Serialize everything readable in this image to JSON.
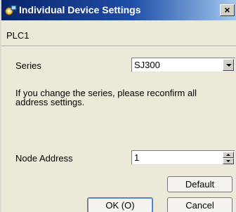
{
  "window": {
    "title": "Individual Device Settings",
    "close_label": "×"
  },
  "device": {
    "name": "PLC1"
  },
  "series": {
    "label": "Series",
    "selected": "SJ300"
  },
  "info_text": "If you change the series, please reconfirm all address settings.",
  "node_address": {
    "label": "Node Address",
    "value": "1"
  },
  "buttons": {
    "default": "Default",
    "ok": "OK (O)",
    "cancel": "Cancel"
  },
  "icons": {
    "title": "device-settings-icon",
    "dropdown": "chevron-down-icon",
    "spin_up": "spin-up-icon",
    "spin_down": "spin-down-icon"
  },
  "colors": {
    "titlebar_start": "#0a246a",
    "titlebar_end": "#a6caf0",
    "dialog_bg": "#ece9d8"
  }
}
